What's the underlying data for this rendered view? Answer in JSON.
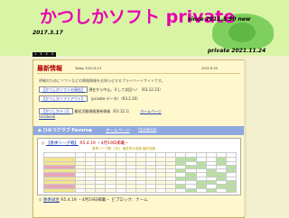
{
  "header": {
    "title": "かつしかソフト private",
    "since_line1": "since 2011.3.30     new",
    "since_line2": "2017.3.17",
    "private_date": "private 2021.11.24",
    "counter": "1 5 3 4 4 0"
  },
  "news": {
    "title": "最新情報",
    "today": "Today   2021.6.13",
    "today_right": "2021.6.30",
    "intro": "明確のためにソフトなどの情報情報をお知らせするプライベートサイトです。",
    "items": [
      {
        "link": "【かつしかソフトの現在】",
        "text": " 現在から中止。そして次回へ！（R3.12.23）"
      },
      {
        "link": "【かつしかソフトアウト】",
        "text": " （private データ）（R3.2.20）"
      },
      {
        "link": "【かつしかテン】",
        "text": " 最初活動情報更新情報（R3.12.1）",
        "extra": "ホームページ"
      }
    ],
    "facebook": "facebook"
  },
  "favorites": {
    "title": "◆ ひみつクラブ Favors◆",
    "home_link": "ホームページ",
    "fb_link": "facebook"
  },
  "standings": {
    "prefix": "◇",
    "league_link": "【春季リーグ戦】",
    "date": " R5.4.19 ・4月19日掲載・",
    "subtitle": "春季リーグ戦 【本】 最終的な成績 最終成績",
    "rows": [
      "",
      "",
      "",
      "",
      "",
      "",
      "",
      "",
      ""
    ]
  },
  "next": {
    "prefix": "◇",
    "link": "春季試合",
    "text": "  R5.4.19 ・4月19日掲載・ ビブロック：ナーム"
  }
}
